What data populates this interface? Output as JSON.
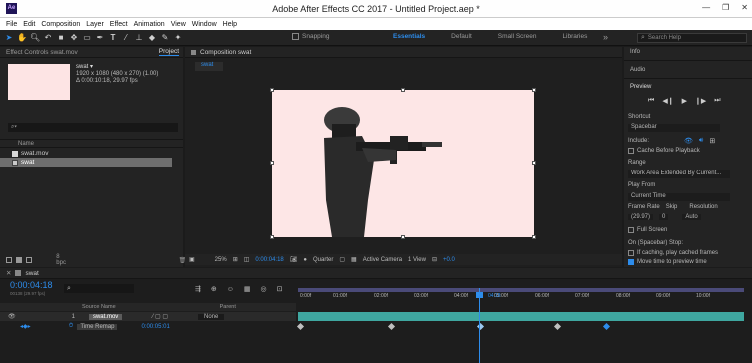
{
  "window": {
    "title": "Adobe After Effects CC 2017 - Untitled Project.aep *",
    "app_icon": "Ae",
    "controls": [
      "—",
      "❐",
      "✕"
    ]
  },
  "menu": [
    "File",
    "Edit",
    "Composition",
    "Layer",
    "Effect",
    "Animation",
    "View",
    "Window",
    "Help"
  ],
  "toolbar": {
    "snapping": "Snapping",
    "workspaces": [
      "Essentials",
      "Default",
      "Small Screen",
      "Libraries"
    ],
    "search_placeholder": "Search Help",
    "chevron": "»"
  },
  "project_panel": {
    "tab_effects": "Effect Controls swat.mov",
    "tab_project": "Project",
    "item_name": "swat ▾",
    "item_info1": "1920 x 1080  (480 x 270) (1.00)",
    "item_info2": "Δ 0:00:10:18, 29.97 fps",
    "col_name": "Name",
    "items": [
      "swat.mov",
      "swat"
    ],
    "bpc": "8 bpc",
    "thumb_color": "#fde4e4"
  },
  "comp_panel": {
    "tab": "Composition swat",
    "subtab": "swat",
    "zoom": "25%",
    "timecode": "0:00:04:18",
    "resolution": "Quarter",
    "camera": "Active Camera",
    "views": "1 View",
    "exposure": "+0.0",
    "bg_color": "#fde6e6"
  },
  "right_panel": {
    "info": "Info",
    "audio": "Audio",
    "preview": "Preview",
    "shortcut_label": "Shortcut",
    "shortcut_value": "Spacebar",
    "include_label": "Include:",
    "cache_before": "Cache Before Playback",
    "range_label": "Range",
    "range_value": "Work Area Extended By Current...",
    "play_from_label": "Play From",
    "play_from_value": "Current Time",
    "frame_rate_label": "Frame Rate",
    "skip_label": "Skip",
    "resolution_label": "Resolution",
    "frame_rate_value": "(29.97)",
    "skip_value": "0",
    "resolution_value": "Auto",
    "full_screen": "Full Screen",
    "stop_label": "On (Spacebar) Stop:",
    "if_caching": "If caching, play cached frames",
    "move_time": "Move time to preview time"
  },
  "timeline": {
    "tab": "swat",
    "timecode": "0:00:04:18",
    "fps_sub": "00138 (29.97 fps)",
    "col_source": "Source Name",
    "col_parent": "Parent",
    "layer_num": "1",
    "layer_name": "swat.mov",
    "parent_value": "None",
    "prop_name": "Time Remap",
    "prop_value": "0:00:05:01",
    "ruler": [
      "0:00f",
      "01:00f",
      "02:00f",
      "03:00f",
      "04:00f",
      "05:00f",
      "06:00f",
      "07:00f",
      "08:00f",
      "09:00f",
      "10:00f"
    ],
    "playhead_label": "04:18"
  },
  "icons": [
    "ae-app-icon",
    "selection-tool-icon",
    "hand-tool-icon",
    "zoom-tool-icon",
    "rotate-tool-icon",
    "camera-tool-icon",
    "pan-behind-icon",
    "rectangle-tool-icon",
    "pen-tool-icon",
    "text-tool-icon",
    "brush-tool-icon",
    "stamp-tool-icon",
    "eraser-tool-icon",
    "roto-brush-icon",
    "puppet-tool-icon",
    "search-icon",
    "play-icon",
    "first-frame-icon",
    "last-frame-icon"
  ],
  "colors": {
    "accent": "#2d8ceb",
    "layer_bar": "#3fa7a0",
    "selection": "#888888",
    "workarea": "#4a4a78"
  }
}
